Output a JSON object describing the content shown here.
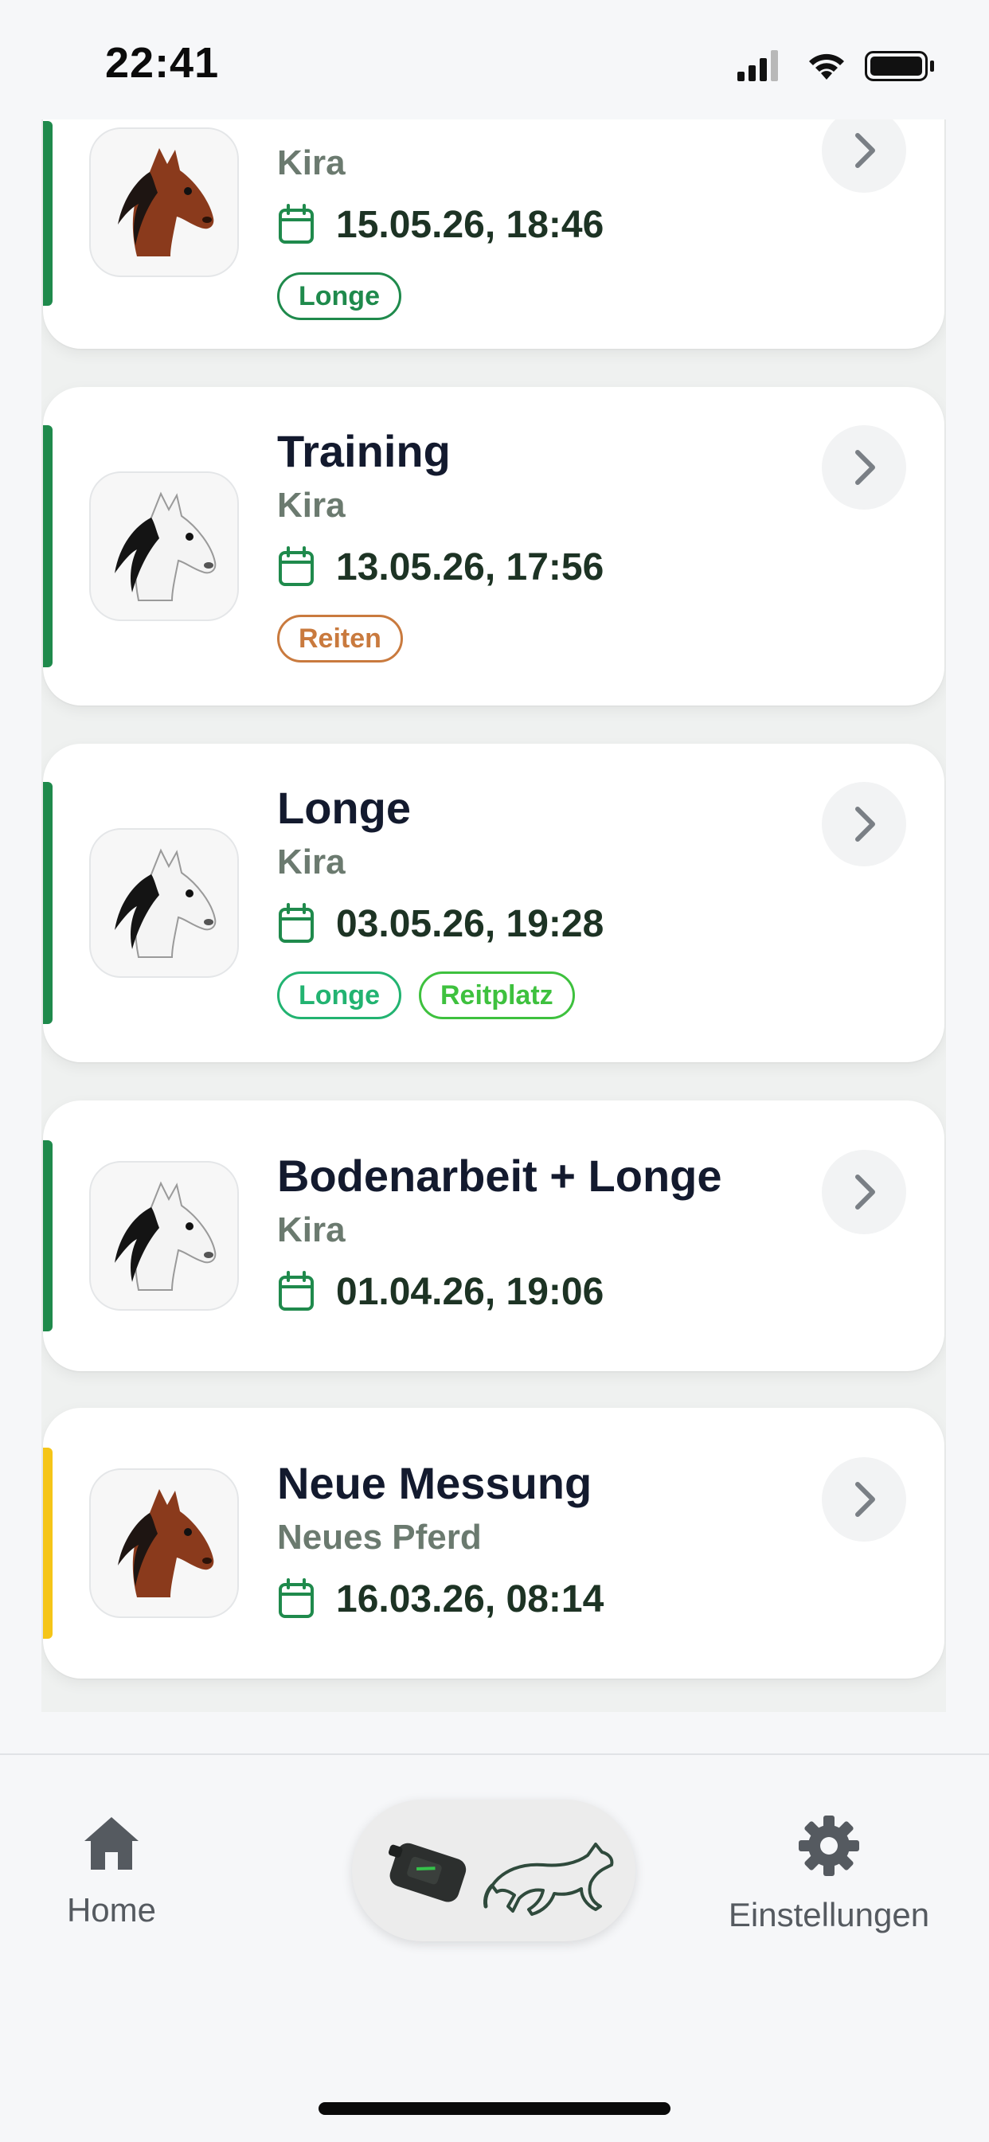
{
  "status_bar": {
    "time": "22:41"
  },
  "sessions": [
    {
      "title": "",
      "horse": "Kira",
      "date": "15.05.26, 18:46",
      "accent": "#1f8a4c",
      "avatar": "brown-horse",
      "tags": [
        {
          "label": "Longe",
          "color": "#1f8a4c"
        }
      ]
    },
    {
      "title": "Training",
      "horse": "Kira",
      "date": "13.05.26, 17:56",
      "accent": "#1f8a4c",
      "avatar": "white-horse",
      "tags": [
        {
          "label": "Reiten",
          "color": "#c97a3e"
        }
      ]
    },
    {
      "title": "Longe",
      "horse": "Kira",
      "date": "03.05.26, 19:28",
      "accent": "#1f8a4c",
      "avatar": "white-horse",
      "tags": [
        {
          "label": "Longe",
          "color": "#22b371"
        },
        {
          "label": "Reitplatz",
          "color": "#3ec13e"
        }
      ]
    },
    {
      "title": "Bodenarbeit + Longe",
      "horse": "Kira",
      "date": "01.04.26, 19:06",
      "accent": "#1f8a4c",
      "avatar": "white-horse",
      "tags": []
    },
    {
      "title": "Neue Messung",
      "horse": "Neues Pferd",
      "date": "16.03.26, 08:14",
      "accent": "#f5c518",
      "avatar": "brown-horse",
      "tags": []
    }
  ],
  "tabbar": {
    "home_label": "Home",
    "settings_label": "Einstellungen",
    "home_icon": "home-icon",
    "settings_icon": "gear-icon",
    "center_icon": "sensor-horse-icon"
  }
}
